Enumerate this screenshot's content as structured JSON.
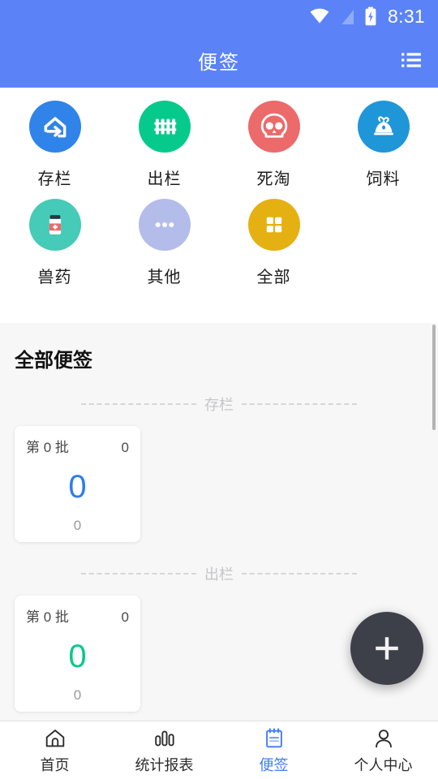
{
  "status_bar": {
    "time": "8:31",
    "icons": [
      "wifi-icon",
      "signal-off-icon",
      "battery-charging-icon"
    ]
  },
  "app_bar": {
    "title": "便签",
    "action_icon": "list-menu-icon"
  },
  "categories": [
    {
      "label": "存栏",
      "icon": "house-arrow-in-icon",
      "color": "#3083e8"
    },
    {
      "label": "出栏",
      "icon": "fence-gate-icon",
      "color": "#06ca8c"
    },
    {
      "label": "死淘",
      "icon": "skull-icon",
      "color": "#ec6a6a"
    },
    {
      "label": "饲料",
      "icon": "feed-sack-icon",
      "color": "#1f96d8"
    },
    {
      "label": "兽药",
      "icon": "medicine-bottle-icon",
      "color": "#45cbb7"
    },
    {
      "label": "其他",
      "icon": "ellipsis-icon",
      "color": "#b4bce9"
    },
    {
      "label": "全部",
      "icon": "grid-four-icon",
      "color": "#e5b011"
    }
  ],
  "notes": {
    "heading": "全部便签",
    "sections": [
      {
        "label": "存栏",
        "cards": [
          {
            "batch": "第 0 批",
            "count": "0",
            "value": "0",
            "value_color": "#2b7df0",
            "footer": "0"
          }
        ]
      },
      {
        "label": "出栏",
        "cards": [
          {
            "batch": "第 0 批",
            "count": "0",
            "value": "0",
            "value_color": "#06ca8c",
            "footer": "0"
          }
        ]
      }
    ]
  },
  "fab": {
    "icon": "plus-icon",
    "color": "#3e4049"
  },
  "bottom_nav": {
    "active_color": "#3e7bfa",
    "items": [
      {
        "label": "首页",
        "icon": "home-icon",
        "active": false
      },
      {
        "label": "统计报表",
        "icon": "bar-chart-icon",
        "active": false
      },
      {
        "label": "便签",
        "icon": "notepad-icon",
        "active": true
      },
      {
        "label": "个人中心",
        "icon": "person-icon",
        "active": false
      }
    ]
  },
  "theme": {
    "header_blue": "#5b83f7",
    "page_background": "#f7f7f8",
    "card_background": "#ffffff"
  }
}
